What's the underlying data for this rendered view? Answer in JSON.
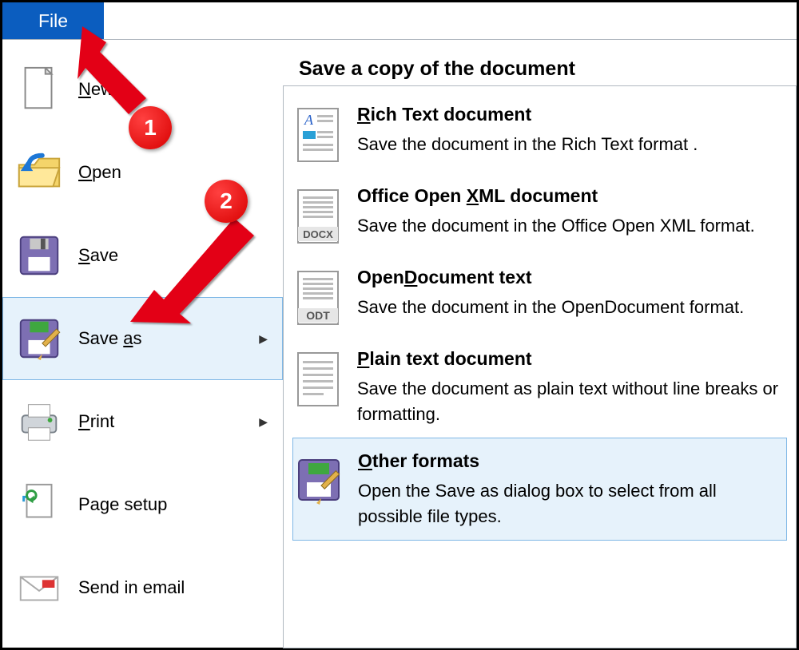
{
  "menubar": {
    "file_label": "File"
  },
  "sidebar": {
    "items": [
      {
        "label": "New",
        "underline_index": 0
      },
      {
        "label": "Open",
        "underline_index": 0
      },
      {
        "label": "Save",
        "underline_index": 0
      },
      {
        "label": "Save as",
        "underline_index": 5,
        "selected": true,
        "has_submenu": true
      },
      {
        "label": "Print",
        "underline_index": 0,
        "has_submenu": true
      },
      {
        "label": "Page setup"
      },
      {
        "label": "Send in email"
      }
    ]
  },
  "panel": {
    "title": "Save a copy of the document",
    "options": [
      {
        "title": "Rich Text document",
        "underline_index": 0,
        "desc": "Save the document in the Rich Text format ."
      },
      {
        "title": "Office Open XML document",
        "underline_index": 12,
        "desc": "Save the document in the Office Open XML format."
      },
      {
        "title": "OpenDocument text",
        "underline_index": 4,
        "desc": "Save the document in the OpenDocument format."
      },
      {
        "title": "Plain text document",
        "underline_index": 0,
        "desc": "Save the document as plain text without line breaks or formatting."
      },
      {
        "title": "Other formats",
        "underline_index": 0,
        "selected": true,
        "desc": "Open the Save as dialog box to select from all possible file types."
      }
    ]
  },
  "annotations": {
    "badges": [
      {
        "n": "1"
      },
      {
        "n": "2"
      }
    ]
  }
}
